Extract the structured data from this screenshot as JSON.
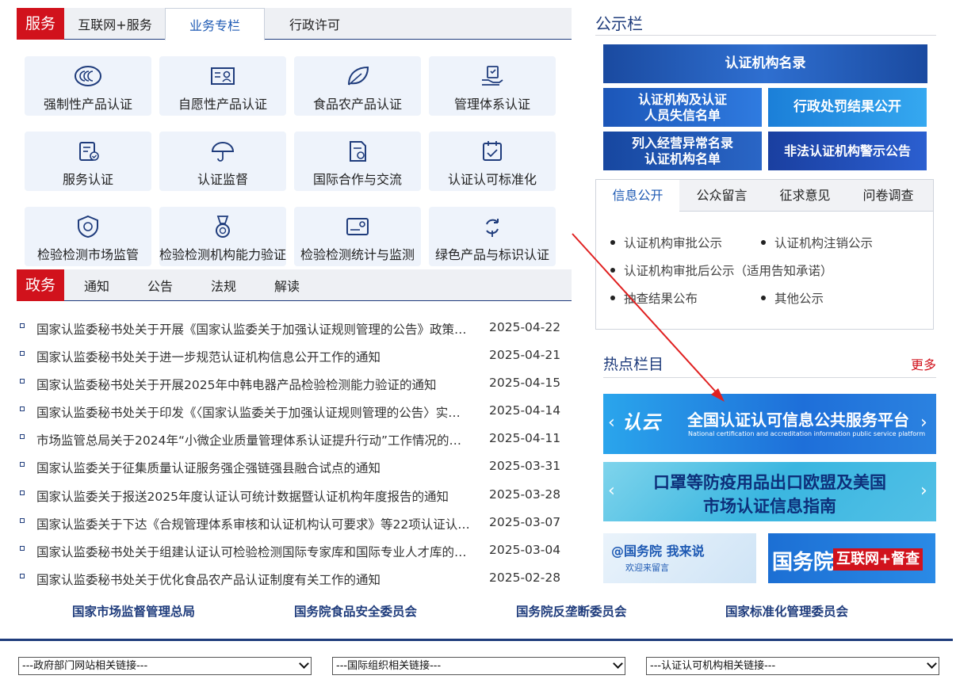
{
  "service": {
    "badge": "服务",
    "tabs": [
      {
        "label": "互联网+服务"
      },
      {
        "label": "业务专栏"
      },
      {
        "label": "行政许可"
      }
    ],
    "active_tab": "业务专栏",
    "tiles": [
      {
        "label": "强制性产品认证",
        "icon": "ccc-icon"
      },
      {
        "label": "自愿性产品认证",
        "icon": "certificate-icon"
      },
      {
        "label": "食品农产品认证",
        "icon": "leaf-icon"
      },
      {
        "label": "管理体系认证",
        "icon": "hand-cert-icon"
      },
      {
        "label": "服务认证",
        "icon": "service-doc-icon"
      },
      {
        "label": "认证监督",
        "icon": "umbrella-icon"
      },
      {
        "label": "国际合作与交流",
        "icon": "document-exchange-icon"
      },
      {
        "label": "认证认可标准化",
        "icon": "checklist-icon"
      },
      {
        "label": "检验检测市场监管",
        "icon": "shield-icon"
      },
      {
        "label": "检验检测机构能力验证",
        "icon": "medal-icon"
      },
      {
        "label": "检验检测统计与监测",
        "icon": "monitor-card-icon"
      },
      {
        "label": "绿色产品与标识认证",
        "icon": "recycle-icon"
      }
    ]
  },
  "gov": {
    "badge": "政务",
    "tabs": [
      {
        "label": "通知"
      },
      {
        "label": "公告"
      },
      {
        "label": "法规"
      },
      {
        "label": "解读"
      }
    ],
    "news": [
      {
        "title": "国家认监委秘书处关于开展《国家认监委关于加强认证规则管理的公告》政策…",
        "date": "2025-04-22"
      },
      {
        "title": "国家认监委秘书处关于进一步规范认证机构信息公开工作的通知",
        "date": "2025-04-21"
      },
      {
        "title": "国家认监委秘书处关于开展2025年中韩电器产品检验检测能力验证的通知",
        "date": "2025-04-15"
      },
      {
        "title": "国家认监委秘书处关于印发《〈国家认监委关于加强认证规则管理的公告〉实…",
        "date": "2025-04-14"
      },
      {
        "title": "市场监管总局关于2024年“小微企业质量管理体系认证提升行动”工作情况的…",
        "date": "2025-04-11"
      },
      {
        "title": "国家认监委关于征集质量认证服务强企强链强县融合试点的通知",
        "date": "2025-03-31"
      },
      {
        "title": "国家认监委关于报送2025年度认证认可统计数据暨认证机构年度报告的通知",
        "date": "2025-03-28"
      },
      {
        "title": "国家认监委关于下达《合规管理体系审核和认证机构认可要求》等22项认证认…",
        "date": "2025-03-07"
      },
      {
        "title": "国家认监委秘书处关于组建认证认可检验检测国际专家库和国际专业人才库的…",
        "date": "2025-03-04"
      },
      {
        "title": "国家认监委秘书处关于优化食品农产品认证制度有关工作的通知",
        "date": "2025-02-28"
      }
    ]
  },
  "footer": {
    "links": [
      "国家市场监督管理总局",
      "国务院食品安全委员会",
      "国务院反垄断委员会",
      "国家标准化管理委员会"
    ],
    "selects": [
      "---政府部门网站相关链接---",
      "---国际组织相关链接---",
      "---认证认可机构相关链接---"
    ]
  },
  "notice": {
    "title": "公示栏",
    "banners": [
      "认证机构名录",
      "认证机构及认证人员失信名单",
      "行政处罚结果公开",
      "列入经营异常名录认证机构名单",
      "非法认证机构警示公告"
    ],
    "banner_lines": {
      "b2": [
        "认证机构及认证",
        "人员失信名单"
      ],
      "b4": [
        "列入经营异常名录",
        "认证机构名单"
      ]
    },
    "info_tabs": [
      {
        "label": "信息公开"
      },
      {
        "label": "公众留言"
      },
      {
        "label": "征求意见"
      },
      {
        "label": "问卷调查"
      }
    ],
    "info_items": [
      "认证机构审批公示",
      "认证机构注销公示",
      "认证机构审批后公示（适用告知承诺）",
      "抽查结果公布",
      "其他公示"
    ]
  },
  "hot": {
    "title": "热点栏目",
    "more": "更多",
    "platform": {
      "logo": "认云",
      "title": "全国认证认可信息公共服务平台",
      "subtitle": "National certification and accreditation information public service platform"
    },
    "mask": {
      "line1": "口罩等防疫用品出口欧盟及美国",
      "line2": "市场认证信息指南"
    },
    "council_say": {
      "line1": "@国务院 我来说",
      "line2": "欢迎来留言"
    },
    "supervise": {
      "brand": "国务院",
      "tag": "互联网+督查"
    }
  },
  "colors": {
    "brand_red": "#d1121c",
    "navy": "#1f3c7c",
    "link_blue": "#1d59b3",
    "annotation_red": "#e02020"
  }
}
